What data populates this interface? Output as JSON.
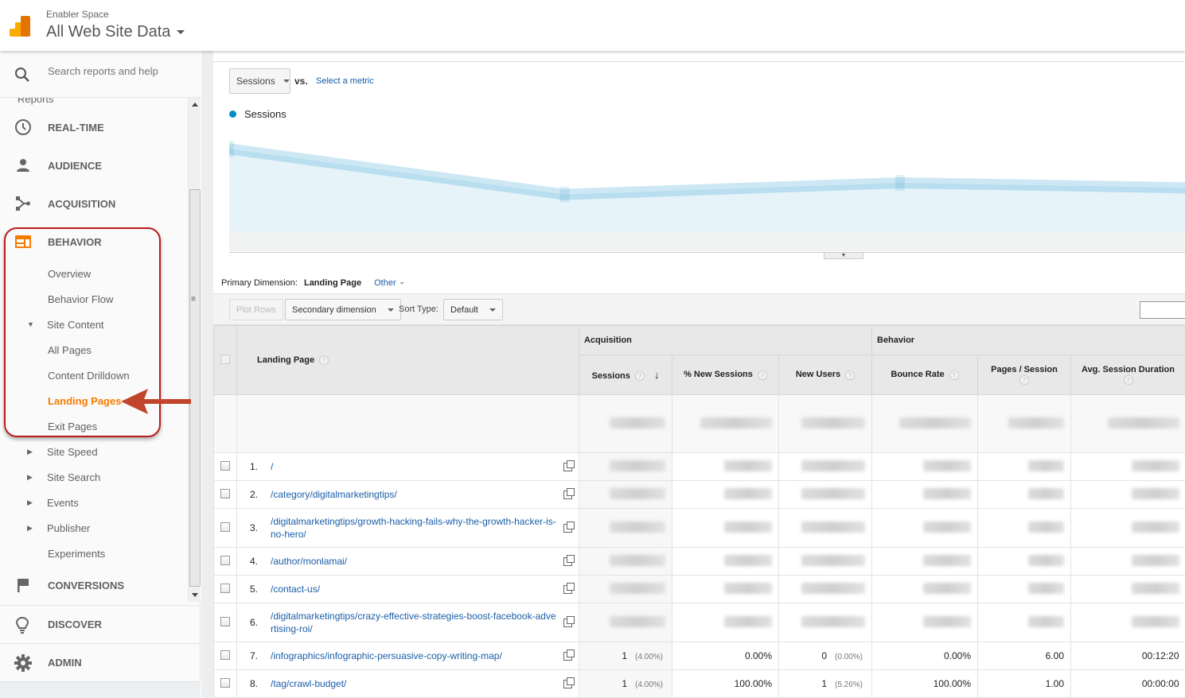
{
  "header": {
    "account": "Enabler Space",
    "property": "All Web Site Data"
  },
  "sidebar": {
    "search_placeholder": "Search reports and help",
    "section_label": "Reports",
    "top_items": [
      {
        "label": "REAL-TIME",
        "icon": "clock-icon"
      },
      {
        "label": "AUDIENCE",
        "icon": "person-icon"
      },
      {
        "label": "ACQUISITION",
        "icon": "acquisition-icon"
      },
      {
        "label": "BEHAVIOR",
        "icon": "behavior-icon"
      }
    ],
    "behavior_items": [
      {
        "label": "Overview"
      },
      {
        "label": "Behavior Flow"
      },
      {
        "label": "Site Content",
        "expanded": true
      },
      {
        "label": "All Pages"
      },
      {
        "label": "Content Drilldown"
      },
      {
        "label": "Landing Pages",
        "active": true
      },
      {
        "label": "Exit Pages"
      },
      {
        "label": "Site Speed",
        "collapsed": true
      },
      {
        "label": "Site Search",
        "collapsed": true
      },
      {
        "label": "Events",
        "collapsed": true
      },
      {
        "label": "Publisher",
        "collapsed": true
      },
      {
        "label": "Experiments"
      }
    ],
    "conversions": "CONVERSIONS",
    "discover": "DISCOVER",
    "admin": "ADMIN"
  },
  "chart": {
    "metric_select": "Sessions",
    "vs_label": "vs.",
    "select_metric": "Select a metric",
    "legend": "Sessions",
    "series_color": "#058dc7"
  },
  "chart_data": {
    "type": "area",
    "title": "",
    "series": [
      {
        "name": "Sessions",
        "values": [
          0.85,
          0.38,
          0.5,
          0.44
        ]
      }
    ],
    "note": "Axis labels and values are blurred in the screenshot; values are relative shape only",
    "xlabel": "",
    "ylabel": ""
  },
  "report": {
    "primary_dimension_label": "Primary Dimension:",
    "primary_dimension": "Landing Page",
    "other": "Other",
    "plot_rows": "Plot Rows",
    "secondary_dimension": "Secondary dimension",
    "sort_type_label": "Sort Type:",
    "sort_type": "Default"
  },
  "table": {
    "group_headers": {
      "acquisition": "Acquisition",
      "behavior": "Behavior"
    },
    "columns": {
      "landing_page": "Landing Page",
      "sessions": "Sessions",
      "new_sessions_pct": "% New Sessions",
      "new_users": "New Users",
      "bounce_rate": "Bounce Rate",
      "pages_session": "Pages / Session",
      "avg_duration": "Avg. Session Duration"
    },
    "rows": [
      {
        "num": "1.",
        "page": "/",
        "blurred": true
      },
      {
        "num": "2.",
        "page": "/category/digitalmarketingtips/",
        "blurred": true
      },
      {
        "num": "3.",
        "page": "/digitalmarketingtips/growth-hacking-fails-why-the-growth-hacker-is-no-hero/",
        "blurred": true
      },
      {
        "num": "4.",
        "page": "/author/monlamai/",
        "blurred": true
      },
      {
        "num": "5.",
        "page": "/contact-us/",
        "blurred": true
      },
      {
        "num": "6.",
        "page": "/digitalmarketingtips/crazy-effective-strategies-boost-facebook-advertising-roi/",
        "blurred": true
      },
      {
        "num": "7.",
        "page": "/infographics/infographic-persuasive-copy-writing-map/",
        "sessions": "1",
        "sessions_pct": "(4.00%)",
        "new_sessions_pct": "0.00%",
        "new_users": "0",
        "new_users_pct": "(0.00%)",
        "bounce_rate": "0.00%",
        "pages_session": "6.00",
        "avg_duration": "00:12:20"
      },
      {
        "num": "8.",
        "page": "/tag/crawl-budget/",
        "sessions": "1",
        "sessions_pct": "(4.00%)",
        "new_sessions_pct": "100.00%",
        "new_users": "1",
        "new_users_pct": "(5.26%)",
        "bounce_rate": "100.00%",
        "pages_session": "1.00",
        "avg_duration": "00:00:00"
      }
    ]
  }
}
